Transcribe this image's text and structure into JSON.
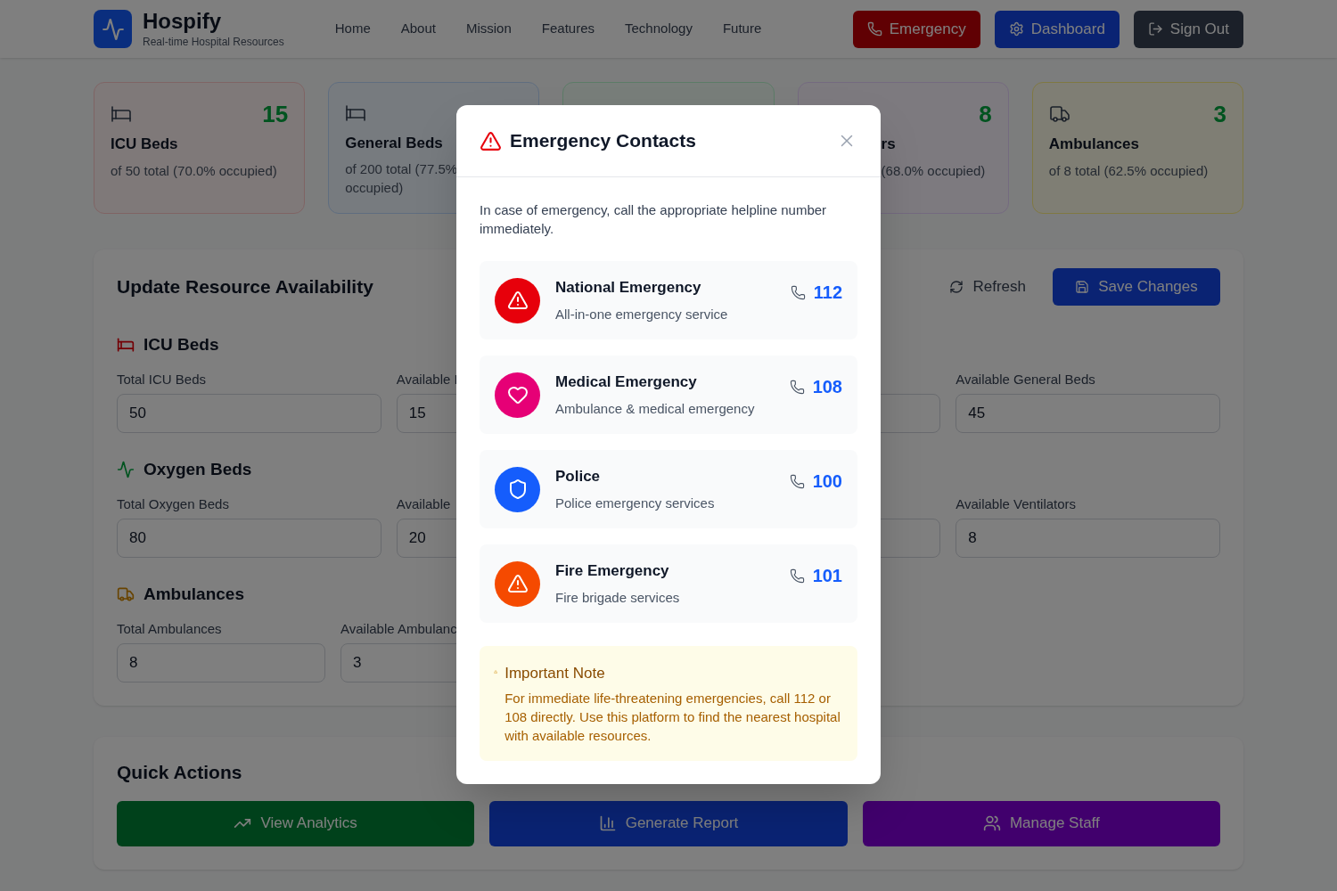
{
  "header": {
    "title": "Hospify",
    "subtitle": "Real-time Hospital Resources",
    "nav": [
      "Home",
      "About",
      "Mission",
      "Features",
      "Technology",
      "Future"
    ],
    "buttons": [
      {
        "kind": "emergency",
        "label": "Emergency"
      },
      {
        "kind": "dashboard",
        "label": "Dashboard"
      },
      {
        "kind": "signout",
        "label": "Sign Out"
      }
    ]
  },
  "stats": [
    {
      "kind": "icu",
      "value": "15",
      "title": "ICU Beds",
      "detail": "of 50 total (70.0% occupied)"
    },
    {
      "kind": "general",
      "title": "General Beds",
      "detail": "of 200 total (77.5% occupied)"
    },
    {
      "kind": "oxygen"
    },
    {
      "kind": "ventilator",
      "value": "8",
      "title": "rs",
      "detail": "(68.0% occupied)"
    },
    {
      "kind": "ambulance",
      "value": "3",
      "title": "Ambulances",
      "detail": "of 8 total (62.5% occupied)"
    }
  ],
  "update": {
    "title": "Update Resource Availability",
    "refresh": "Refresh",
    "save": "Save Changes",
    "groups": [
      {
        "kind": "icu",
        "title": "ICU Beds",
        "fields": [
          {
            "label": "Total ICU Beds",
            "value": "50"
          },
          {
            "label": "Available I",
            "value": "15"
          }
        ],
        "paired_fields": [
          {
            "label": "Available General Beds",
            "value": "45"
          }
        ]
      },
      {
        "kind": "oxygen",
        "title": "Oxygen Beds",
        "fields": [
          {
            "label": "Total Oxygen Beds",
            "value": "80"
          },
          {
            "label": "Available",
            "value": "20"
          }
        ],
        "paired_fields": [
          {
            "label": "Available Ventilators",
            "value": "8"
          }
        ]
      },
      {
        "kind": "ambulance",
        "title": "Ambulances",
        "fields": [
          {
            "label": "Total Ambulances",
            "value": "8"
          },
          {
            "label": "Available Ambulanc",
            "value": "3"
          }
        ]
      }
    ]
  },
  "quick_actions": {
    "title": "Quick Actions",
    "buttons": [
      {
        "kind": "analytics",
        "label": "View Analytics"
      },
      {
        "kind": "report",
        "label": "Generate Report"
      },
      {
        "kind": "staff",
        "label": "Manage Staff"
      }
    ]
  },
  "modal": {
    "title": "Emergency Contacts",
    "intro": "In case of emergency, call the appropriate helpline number immediately.",
    "contacts": [
      {
        "kind": "national",
        "name": "National Emergency",
        "description": "All-in-one emergency service",
        "number": "112"
      },
      {
        "kind": "medical",
        "name": "Medical Emergency",
        "description": "Ambulance & medical emergency",
        "number": "108"
      },
      {
        "kind": "police",
        "name": "Police",
        "description": "Police emergency services",
        "number": "100"
      },
      {
        "kind": "fire",
        "name": "Fire Emergency",
        "description": "Fire brigade services",
        "number": "101"
      }
    ],
    "note": {
      "title": "Important Note",
      "text": "For immediate life-threatening emergencies, call 112 or 108 directly. Use this platform to find the nearest hospital with available resources."
    }
  }
}
